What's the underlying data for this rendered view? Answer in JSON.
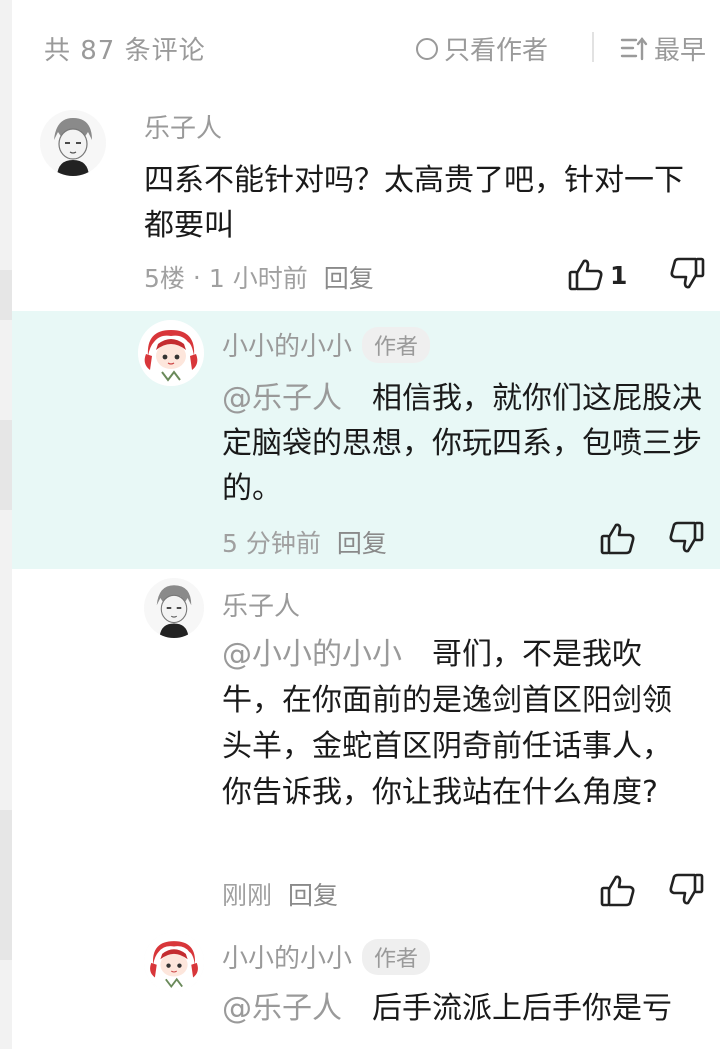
{
  "header": {
    "comment_count": "共 87 条评论",
    "only_author": "只看作者",
    "sort": "最早"
  },
  "comments": [
    {
      "author": "乐子人",
      "text": "四系不能针对吗？太高贵了吧，针对一下都要叫",
      "floor": "5楼",
      "dot": "·",
      "time": "1 小时前",
      "reply": "回复",
      "likes": "1"
    },
    {
      "author": "小小的小小",
      "badge": "作者",
      "mention": "@乐子人",
      "text": "相信我，就你们这屁股决定脑袋的思想，你玩四系，包喷三步的。",
      "time": "5 分钟前",
      "reply": "回复"
    },
    {
      "author": "乐子人",
      "mention": "@小小的小小",
      "text": "哥们，不是我吹牛，在你面前的是逸剑首区阳剑领头羊，金蛇首区阴奇前任话事人，你告诉我，你让我站在什么角度?",
      "time": "刚刚",
      "reply": "回复"
    },
    {
      "author": "小小的小小",
      "badge": "作者",
      "mention": "@乐子人",
      "text": "后手流派上后手你是亏"
    }
  ]
}
